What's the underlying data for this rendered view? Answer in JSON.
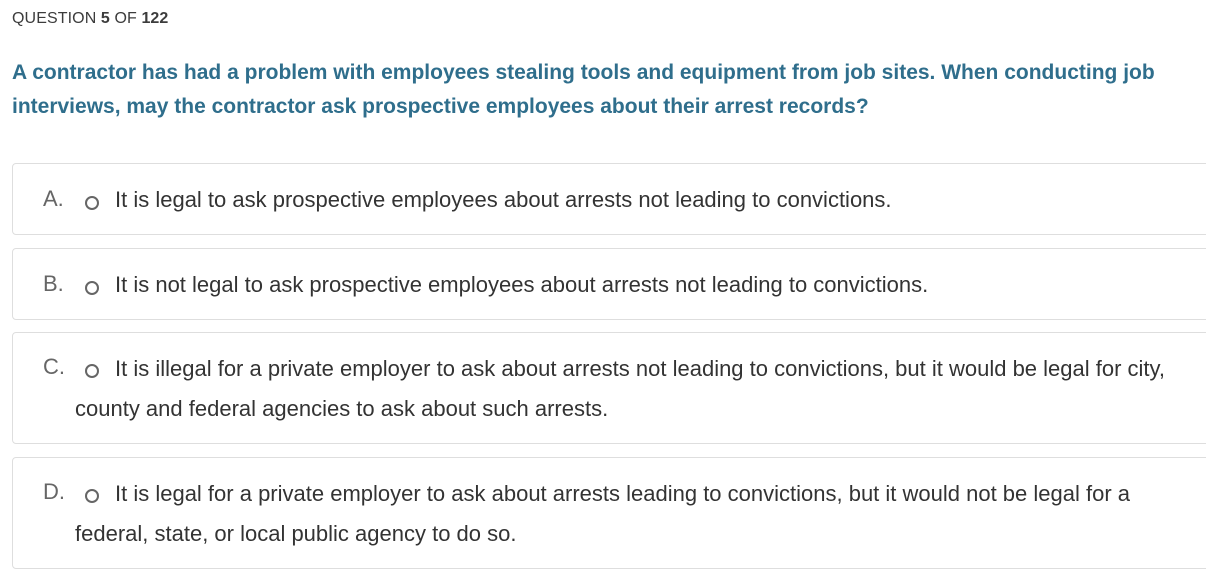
{
  "header": {
    "prefix": "QUESTION",
    "current": "5",
    "sep": "OF",
    "total": "122"
  },
  "question": {
    "text": "A contractor has had a problem with employees stealing tools and equipment from job sites. When conducting job interviews, may the contractor ask prospective employees about their arrest records?"
  },
  "options": [
    {
      "letter": "A.",
      "text": "It is legal to ask prospective employees about arrests not leading to convictions."
    },
    {
      "letter": "B.",
      "text": "It is not legal to ask prospective employees about arrests not leading to convictions."
    },
    {
      "letter": "C.",
      "text": "It is illegal for a private employer to ask about arrests not leading to convictions, but it would be legal for city, county and federal agencies to ask about such arrests."
    },
    {
      "letter": "D.",
      "text": "It is legal for a private employer to ask about arrests leading to convictions, but it would not be legal for a federal, state, or local public agency to do so."
    }
  ]
}
